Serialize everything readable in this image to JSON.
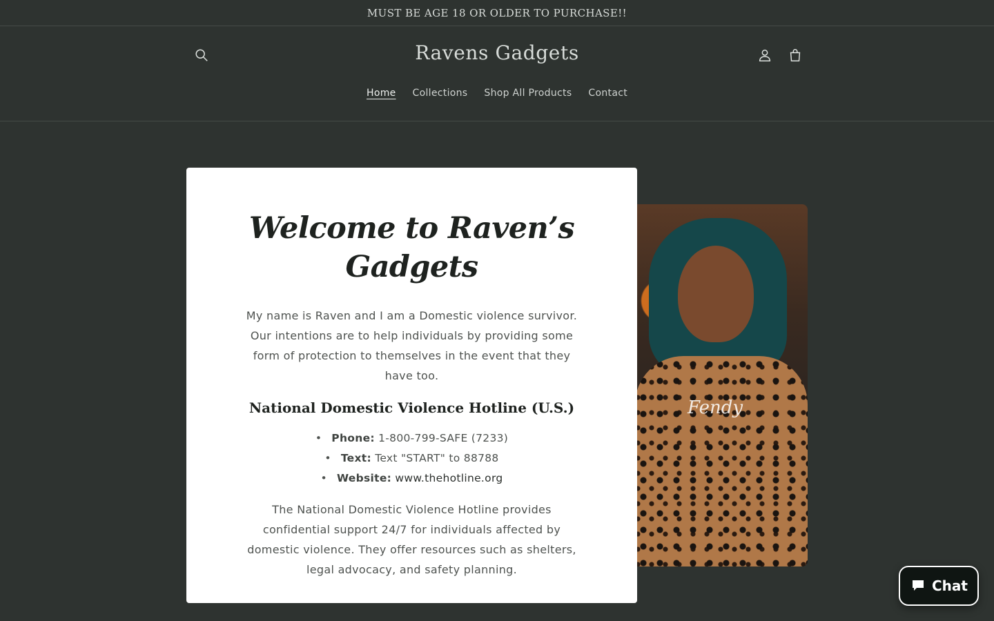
{
  "announcement": {
    "text": "MUST BE AGE 18 OR OLDER TO PURCHASE!!"
  },
  "header": {
    "logo": "Ravens Gadgets",
    "icons": {
      "search": "search-icon",
      "account": "account-icon",
      "cart": "cart-icon"
    }
  },
  "nav": {
    "items": [
      {
        "label": "Home",
        "active": true
      },
      {
        "label": "Collections"
      },
      {
        "label": "Shop All Products"
      },
      {
        "label": "Contact"
      }
    ]
  },
  "hero": {
    "title": "Welcome to Raven’s Gadgets",
    "intro": "My name is Raven and I am a Domestic violence survivor. Our intentions are to help individuals by providing some form of protection to themselves in the event that they have too.",
    "hotline_title": "National Domestic Violence Hotline (U.S.)",
    "contacts": [
      {
        "label": "Phone:",
        "value": "1-800-799-SAFE (7233)"
      },
      {
        "label": "Text:",
        "value": "Text \"START\" to 88788"
      },
      {
        "label": "Website:",
        "value": "www.thehotline.org"
      }
    ],
    "outro": "The National Domestic Violence Hotline provides confidential support 24/7 for individuals affected by domestic violence. They offer resources such as shelters, legal advocacy, and safety planning.",
    "image_watermark": "Fendy"
  },
  "chat": {
    "label": "Chat",
    "icon": "chat-bubble-icon"
  },
  "colors": {
    "background": "#2e3330",
    "card": "#ffffff",
    "text": "#4e524f",
    "heading": "#1e221f"
  }
}
